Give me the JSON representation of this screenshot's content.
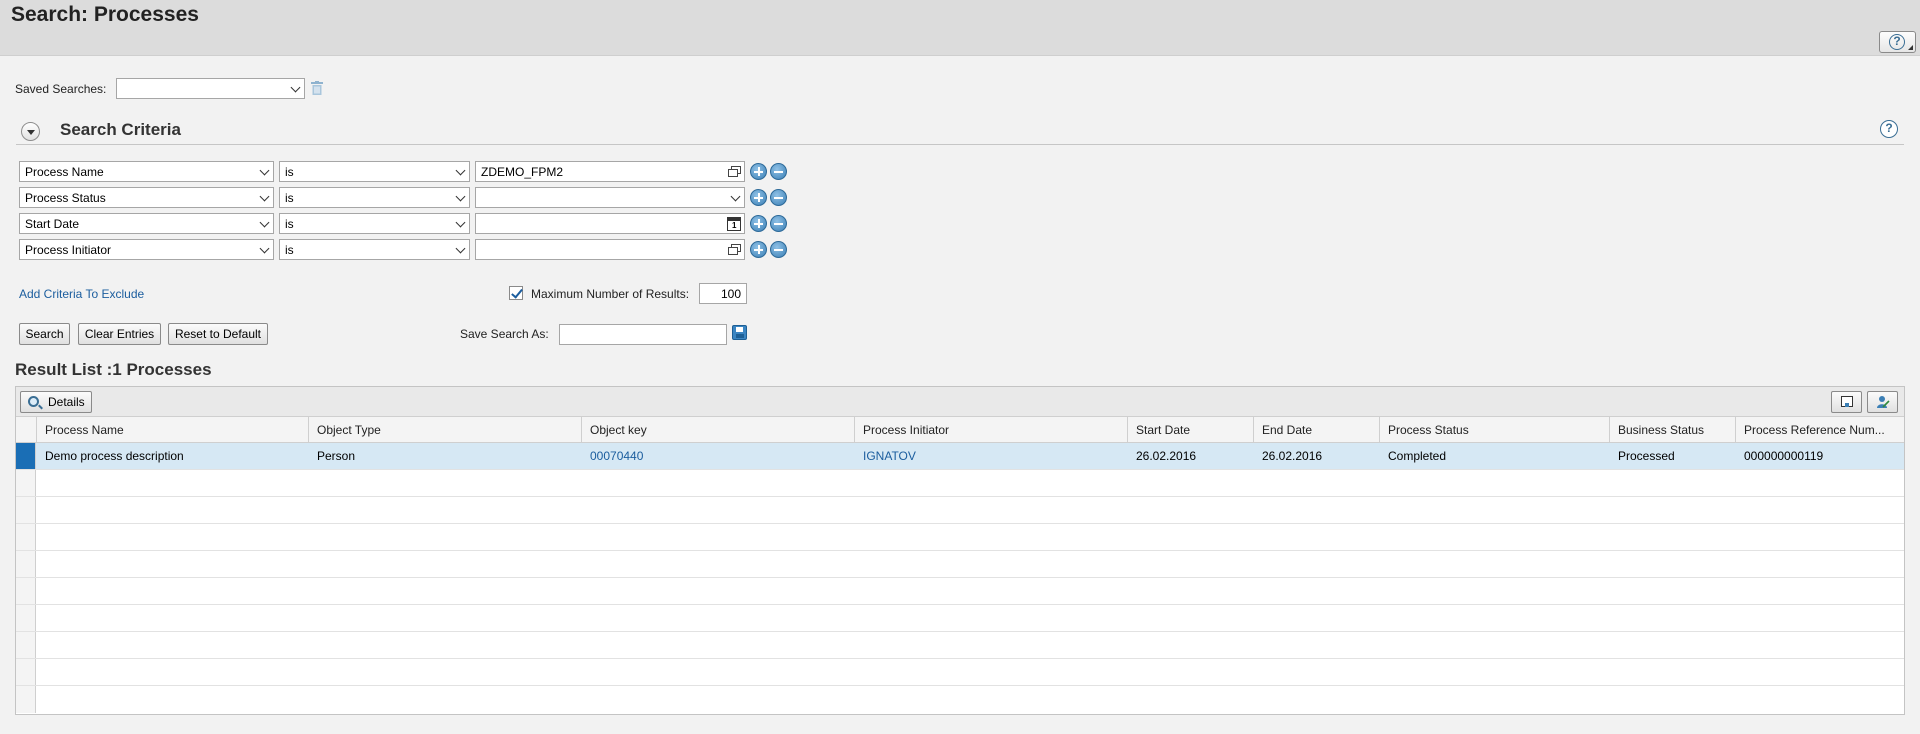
{
  "page": {
    "title": "Search: Processes"
  },
  "saved_searches": {
    "label": "Saved Searches:",
    "value": ""
  },
  "criteria": {
    "title": "Search Criteria",
    "rows": [
      {
        "field": "Process Name",
        "operator": "is",
        "value": "ZDEMO_FPM2",
        "value_type": "value-help"
      },
      {
        "field": "Process Status",
        "operator": "is",
        "value": "",
        "value_type": "dropdown"
      },
      {
        "field": "Start Date",
        "operator": "is",
        "value": "",
        "value_type": "date"
      },
      {
        "field": "Process Initiator",
        "operator": "is",
        "value": "",
        "value_type": "value-help"
      }
    ],
    "add_exclude_link": "Add Criteria To Exclude",
    "max_results_label": "Maximum Number of Results:",
    "max_results_checked": true,
    "max_results_value": "100",
    "buttons": {
      "search": "Search",
      "clear": "Clear Entries",
      "reset": "Reset to Default"
    },
    "save_as_label": "Save Search As:",
    "save_as_value": ""
  },
  "results": {
    "title": "Result List :1 Processes",
    "details_button": "Details",
    "columns": [
      "Process Name",
      "Object Type",
      "Object key",
      "Process Initiator",
      "Start Date",
      "End Date",
      "Process Status",
      "Business Status",
      "Process Reference Num..."
    ],
    "rows": [
      [
        "Demo process description",
        "Person",
        "00070440",
        "IGNATOV",
        "26.02.2016",
        "26.02.2016",
        "Completed",
        "Processed",
        "000000000119"
      ]
    ],
    "link_columns": [
      2,
      3
    ],
    "empty_rows": 9,
    "selected_row": 0
  },
  "icons": {
    "help": "help-icon",
    "trash": "trash-icon",
    "value_help": "value-help-icon",
    "calendar": "calendar-icon",
    "add": "plus-icon",
    "remove": "minus-icon",
    "save": "save-icon",
    "details": "magnifier-icon",
    "export": "export-icon",
    "personalize": "person-settings-icon"
  },
  "colors": {
    "link": "#1b5d9e",
    "selection": "#1a6eb5",
    "row_selected_bg": "#d6e8f4",
    "accent_icon": "#3b7fb5"
  }
}
